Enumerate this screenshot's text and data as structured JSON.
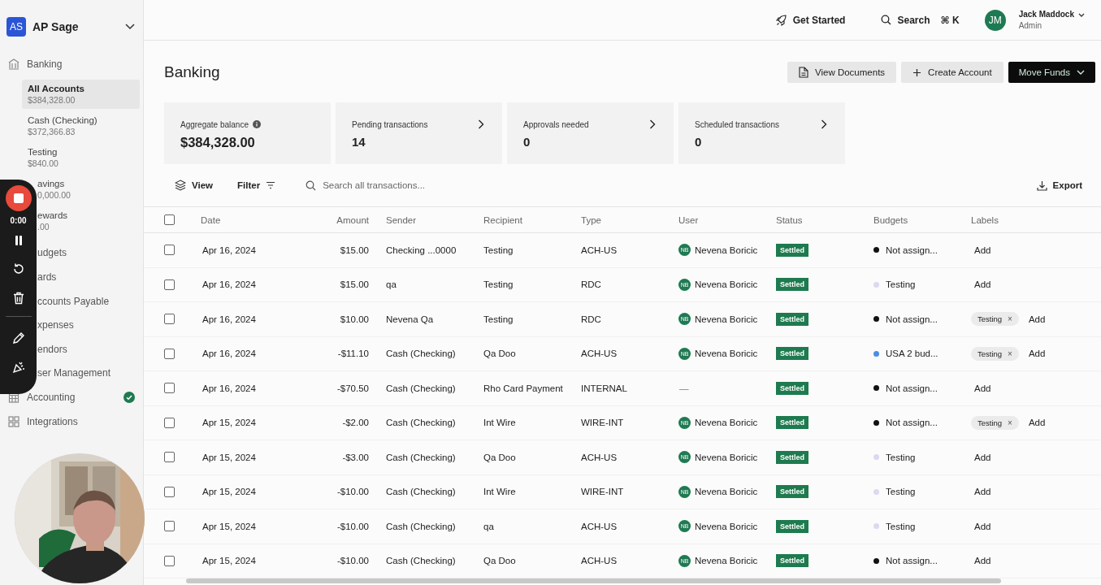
{
  "app": {
    "initials": "AS",
    "name": "AP Sage"
  },
  "sidebar": {
    "section": {
      "label": "Banking"
    },
    "accounts": [
      {
        "name": "All Accounts",
        "balance": "$384,328.00",
        "selected": true,
        "clipped": false
      },
      {
        "name": "Cash (Checking)",
        "balance": "$372,366.83",
        "selected": false,
        "clipped": false
      },
      {
        "name": "Testing",
        "balance": "$840.00",
        "selected": false,
        "clipped": false
      },
      {
        "name": "avings",
        "balance": "0,000.00",
        "selected": false,
        "clipped": true
      },
      {
        "name": "ewards",
        "balance": ".00",
        "selected": false,
        "clipped": true
      }
    ],
    "items": [
      {
        "label": "udgets",
        "clipped": true,
        "done": false
      },
      {
        "label": "ards",
        "clipped": true,
        "done": false
      },
      {
        "label": "ccounts Payable",
        "clipped": true,
        "done": false
      },
      {
        "label": "xpenses",
        "clipped": true,
        "done": false
      },
      {
        "label": "endors",
        "clipped": true,
        "done": false
      },
      {
        "label": "ser Management",
        "clipped": true,
        "done": false
      },
      {
        "label": "Accounting",
        "clipped": false,
        "done": true
      },
      {
        "label": "Integrations",
        "clipped": false,
        "done": false
      }
    ]
  },
  "recorder": {
    "timer": "0:00"
  },
  "header": {
    "get_started": "Get Started",
    "search": "Search",
    "shortcut": "⌘ K",
    "user": {
      "initials": "JM",
      "name": "Jack Maddock",
      "role": "Admin"
    }
  },
  "page": {
    "title": "Banking",
    "actions": [
      {
        "label": "View Documents",
        "kind": "documents"
      },
      {
        "label": "Create Account",
        "kind": "create"
      },
      {
        "label": "Move Funds",
        "kind": "primary"
      }
    ]
  },
  "cards": [
    {
      "label": "Aggregate balance",
      "value": "$384,328.00",
      "info": true,
      "link": false
    },
    {
      "label": "Pending transactions",
      "value": "14",
      "info": false,
      "link": true
    },
    {
      "label": "Approvals needed",
      "value": "0",
      "info": false,
      "link": true
    },
    {
      "label": "Scheduled transactions",
      "value": "0",
      "info": false,
      "link": true
    }
  ],
  "toolbar": {
    "view": "View",
    "filter": "Filter",
    "search_placeholder": "Search all transactions...",
    "export": "Export"
  },
  "table": {
    "all_checked": false,
    "columns": [
      "Date",
      "Amount",
      "Sender",
      "Recipient",
      "Type",
      "User",
      "Status",
      "Budgets",
      "Labels"
    ],
    "rows": [
      {
        "checked": false,
        "date": "Apr 16, 2024",
        "amount": "$15.00",
        "sender": "Checking ...0000",
        "recipient": "Testing",
        "type": "ACH-US",
        "user": {
          "initials": "NB",
          "name": "Nevena Boricic"
        },
        "status": "Settled",
        "budget": {
          "label": "Not assign...",
          "color": "#111111"
        },
        "labels": [],
        "add": "Add"
      },
      {
        "checked": false,
        "date": "Apr 16, 2024",
        "amount": "$15.00",
        "sender": "qa",
        "recipient": "Testing",
        "type": "RDC",
        "user": {
          "initials": "NB",
          "name": "Nevena Boricic"
        },
        "status": "Settled",
        "budget": {
          "label": "Testing",
          "color": "#dcd8f0"
        },
        "labels": [],
        "add": "Add"
      },
      {
        "checked": false,
        "date": "Apr 16, 2024",
        "amount": "$10.00",
        "sender": "Nevena Qa",
        "recipient": "Testing",
        "type": "RDC",
        "user": {
          "initials": "NB",
          "name": "Nevena Boricic"
        },
        "status": "Settled",
        "budget": {
          "label": "Not assign...",
          "color": "#111111"
        },
        "labels": [
          {
            "text": "Testing",
            "remove": "×"
          }
        ],
        "add": "Add"
      },
      {
        "checked": false,
        "date": "Apr 16, 2024",
        "amount": "-$11.10",
        "sender": "Cash (Checking)",
        "recipient": "Qa Doo",
        "type": "ACH-US",
        "user": {
          "initials": "NB",
          "name": "Nevena Boricic"
        },
        "status": "Settled",
        "budget": {
          "label": "USA 2 bud...",
          "color": "#4a8fe0"
        },
        "labels": [
          {
            "text": "Testing",
            "remove": "×"
          }
        ],
        "add": "Add"
      },
      {
        "checked": false,
        "date": "Apr 16, 2024",
        "amount": "-$70.50",
        "sender": "Cash (Checking)",
        "recipient": "Rho Card Payment",
        "type": "INTERNAL",
        "user_text": "—",
        "status": "Settled",
        "budget": {
          "label": "Not assign...",
          "color": "#111111"
        },
        "labels": [],
        "add": "Add"
      },
      {
        "checked": false,
        "date": "Apr 15, 2024",
        "amount": "-$2.00",
        "sender": "Cash (Checking)",
        "recipient": "Int Wire",
        "type": "WIRE-INT",
        "user": {
          "initials": "NB",
          "name": "Nevena Boricic"
        },
        "status": "Settled",
        "budget": {
          "label": "Not assign...",
          "color": "#111111"
        },
        "labels": [
          {
            "text": "Testing",
            "remove": "×"
          }
        ],
        "add": "Add"
      },
      {
        "checked": false,
        "date": "Apr 15, 2024",
        "amount": "-$3.00",
        "sender": "Cash (Checking)",
        "recipient": "Qa Doo",
        "type": "ACH-US",
        "user": {
          "initials": "NB",
          "name": "Nevena Boricic"
        },
        "status": "Settled",
        "budget": {
          "label": "Testing",
          "color": "#dcd8f0"
        },
        "labels": [],
        "add": "Add"
      },
      {
        "checked": false,
        "date": "Apr 15, 2024",
        "amount": "-$10.00",
        "sender": "Cash (Checking)",
        "recipient": "Int Wire",
        "type": "WIRE-INT",
        "user": {
          "initials": "NB",
          "name": "Nevena Boricic"
        },
        "status": "Settled",
        "budget": {
          "label": "Testing",
          "color": "#dcd8f0"
        },
        "labels": [],
        "add": "Add"
      },
      {
        "checked": false,
        "date": "Apr 15, 2024",
        "amount": "-$10.00",
        "sender": "Cash (Checking)",
        "recipient": "qa",
        "type": "ACH-US",
        "user": {
          "initials": "NB",
          "name": "Nevena Boricic"
        },
        "status": "Settled",
        "budget": {
          "label": "Testing",
          "color": "#dcd8f0"
        },
        "labels": [],
        "add": "Add"
      },
      {
        "checked": false,
        "date": "Apr 15, 2024",
        "amount": "-$10.00",
        "sender": "Cash (Checking)",
        "recipient": "Qa Doo",
        "type": "ACH-US",
        "user": {
          "initials": "NB",
          "name": "Nevena Boricic"
        },
        "status": "Settled",
        "budget": {
          "label": "Not assign...",
          "color": "#111111"
        },
        "labels": [],
        "add": "Add"
      }
    ]
  }
}
